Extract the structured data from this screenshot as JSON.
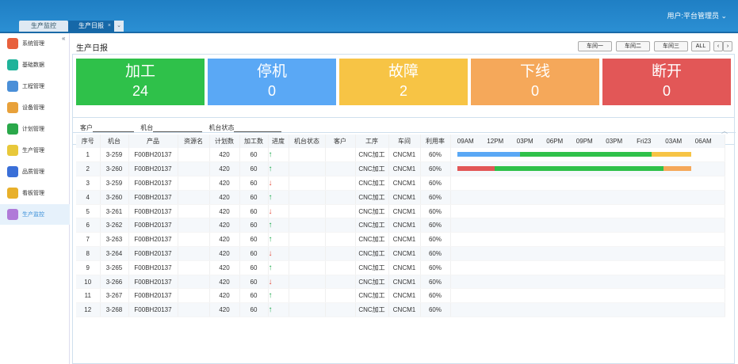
{
  "tabs": [
    {
      "label": "生产监控"
    },
    {
      "label": "生产日报",
      "close": "×"
    }
  ],
  "tab_menu": "⌄",
  "user": "用户:平台管理员 ⌄",
  "collapse": "«",
  "sidebar": {
    "items": [
      {
        "label": "系统管理",
        "color": "#e8603c"
      },
      {
        "label": "基础数据",
        "color": "#1fb39a"
      },
      {
        "label": "工程管理",
        "color": "#4a8fd8"
      },
      {
        "label": "设备管理",
        "color": "#e8a13a"
      },
      {
        "label": "计划管理",
        "color": "#2aa84a"
      },
      {
        "label": "生产管理",
        "color": "#e8c83a"
      },
      {
        "label": "品质管理",
        "color": "#3a6fd8"
      },
      {
        "label": "看板管理",
        "color": "#e8b02a"
      },
      {
        "label": "生产监控",
        "color": "#b07ad8"
      }
    ]
  },
  "page_title": "生产日报",
  "toolbar": {
    "ws1": "车间一",
    "ws2": "车间二",
    "ws3": "车间三",
    "all": "ALL",
    "prev": "‹",
    "next": "›"
  },
  "status_cards": [
    {
      "label": "加工",
      "value": "24",
      "color": "#2fc14a"
    },
    {
      "label": "停机",
      "value": "0",
      "color": "#5aa8f5"
    },
    {
      "label": "故障",
      "value": "2",
      "color": "#f7c445"
    },
    {
      "label": "下线",
      "value": "0",
      "color": "#f5a85a"
    },
    {
      "label": "断开",
      "value": "0",
      "color": "#e25757"
    }
  ],
  "chevron": "︿",
  "filters": {
    "customer": "客户",
    "machine": "机台",
    "machine_status": "机台状态"
  },
  "table": {
    "headers": [
      "序号",
      "机台",
      "产品",
      "资源名",
      "计划数",
      "加工数",
      "进度",
      "机台状态",
      "客户",
      "工序",
      "车间",
      "利用率"
    ],
    "time_ticks": [
      "09AM",
      "12PM",
      "03PM",
      "06PM",
      "09PM",
      "03PM",
      "Fri23",
      "03AM",
      "06AM"
    ],
    "rows": [
      {
        "no": "1",
        "machine": "3-259",
        "product": "F00BH20137",
        "resource": "",
        "plan": "420",
        "done": "60",
        "trend": "↑",
        "process": "CNC加工",
        "workshop": "CNCM1",
        "util": "60%"
      },
      {
        "no": "2",
        "machine": "3-260",
        "product": "F00BH20137",
        "resource": "",
        "plan": "420",
        "done": "60",
        "trend": "↑",
        "process": "CNC加工",
        "workshop": "CNCM1",
        "util": "60%"
      },
      {
        "no": "3",
        "machine": "3-259",
        "product": "F00BH20137",
        "resource": "",
        "plan": "420",
        "done": "60",
        "trend": "↓",
        "process": "CNC加工",
        "workshop": "CNCM1",
        "util": "60%"
      },
      {
        "no": "4",
        "machine": "3-260",
        "product": "F00BH20137",
        "resource": "",
        "plan": "420",
        "done": "60",
        "trend": "↑",
        "process": "CNC加工",
        "workshop": "CNCM1",
        "util": "60%"
      },
      {
        "no": "5",
        "machine": "3-261",
        "product": "F00BH20137",
        "resource": "",
        "plan": "420",
        "done": "60",
        "trend": "↓",
        "process": "CNC加工",
        "workshop": "CNCM1",
        "util": "60%"
      },
      {
        "no": "6",
        "machine": "3-262",
        "product": "F00BH20137",
        "resource": "",
        "plan": "420",
        "done": "60",
        "trend": "↑",
        "process": "CNC加工",
        "workshop": "CNCM1",
        "util": "60%"
      },
      {
        "no": "7",
        "machine": "3-263",
        "product": "F00BH20137",
        "resource": "",
        "plan": "420",
        "done": "60",
        "trend": "↑",
        "process": "CNC加工",
        "workshop": "CNCM1",
        "util": "60%"
      },
      {
        "no": "8",
        "machine": "3-264",
        "product": "F00BH20137",
        "resource": "",
        "plan": "420",
        "done": "60",
        "trend": "↓",
        "process": "CNC加工",
        "workshop": "CNCM1",
        "util": "60%"
      },
      {
        "no": "9",
        "machine": "3-265",
        "product": "F00BH20137",
        "resource": "",
        "plan": "420",
        "done": "60",
        "trend": "↑",
        "process": "CNC加工",
        "workshop": "CNCM1",
        "util": "60%"
      },
      {
        "no": "10",
        "machine": "3-266",
        "product": "F00BH20137",
        "resource": "",
        "plan": "420",
        "done": "60",
        "trend": "↓",
        "process": "CNC加工",
        "workshop": "CNCM1",
        "util": "60%"
      },
      {
        "no": "11",
        "machine": "3-267",
        "product": "F00BH20137",
        "resource": "",
        "plan": "420",
        "done": "60",
        "trend": "↑",
        "process": "CNC加工",
        "workshop": "CNCM1",
        "util": "60%"
      },
      {
        "no": "12",
        "machine": "3-268",
        "product": "F00BH20137",
        "resource": "",
        "plan": "420",
        "done": "60",
        "trend": "↑",
        "process": "CNC加工",
        "workshop": "CNCM1",
        "util": "60%"
      }
    ],
    "timelines": [
      [
        {
          "color": "#5aa8f5",
          "share": 0.27
        },
        {
          "color": "#2fc14a",
          "share": 0.56
        },
        {
          "color": "#f7c445",
          "share": 0.17
        }
      ],
      [
        {
          "color": "#e25757",
          "share": 0.16
        },
        {
          "color": "#2fc14a",
          "share": 0.72
        },
        {
          "color": "#f5a85a",
          "share": 0.12
        }
      ]
    ]
  }
}
